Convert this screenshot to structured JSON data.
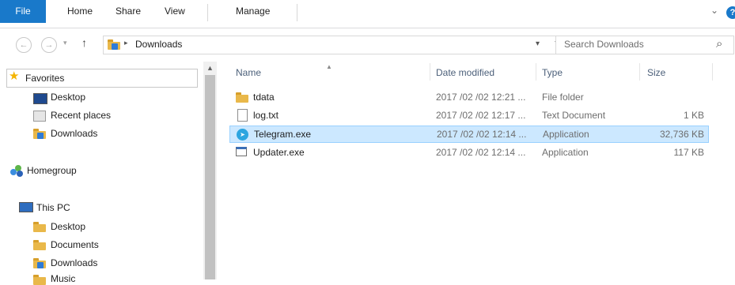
{
  "ribbon": {
    "tabs": [
      "File",
      "Home",
      "Share",
      "View",
      "Manage"
    ],
    "expand_glyph": "⌄",
    "help_glyph": "?"
  },
  "address": {
    "back_glyph": "←",
    "forward_glyph": "→",
    "recent_glyph": "▾",
    "up_glyph": "↑",
    "crumb_sep": "▸",
    "path": "Downloads",
    "dropdown_glyph": "▾",
    "refresh_glyph": "↻",
    "search_placeholder": "Search Downloads",
    "search_glyph": "⌕"
  },
  "nav_pane": {
    "favorites": {
      "label": "Favorites",
      "icon": "star-icon",
      "icon_color": "#f4b400"
    },
    "favorite_items": [
      {
        "label": "Desktop",
        "icon": "desktop-icon"
      },
      {
        "label": "Recent places",
        "icon": "recent-places-icon"
      },
      {
        "label": "Downloads",
        "icon": "downloads-folder-icon"
      }
    ],
    "homegroup": {
      "label": "Homegroup",
      "icon": "homegroup-icon"
    },
    "this_pc": {
      "label": "This PC",
      "icon": "computer-icon"
    },
    "pc_items": [
      {
        "label": "Desktop",
        "icon": "folder-icon"
      },
      {
        "label": "Documents",
        "icon": "documents-folder-icon"
      },
      {
        "label": "Downloads",
        "icon": "downloads-folder-icon"
      },
      {
        "label": "Music",
        "icon": "music-folder-icon"
      }
    ]
  },
  "file_list": {
    "columns": [
      "Name",
      "Date modified",
      "Type",
      "Size"
    ],
    "rows": [
      {
        "name": "tdata",
        "date": "2017 /02 /02 12:21 ...",
        "type": "File folder",
        "size": "",
        "icon": "folder-icon",
        "selected": false
      },
      {
        "name": "log.txt",
        "date": "2017 /02 /02 12:17 ...",
        "type": "Text Document",
        "size": "1 KB",
        "icon": "text-file-icon",
        "selected": false
      },
      {
        "name": "Telegram.exe",
        "date": "2017 /02 /02 12:14 ...",
        "type": "Application",
        "size": "32,736 KB",
        "icon": "telegram-icon",
        "selected": true
      },
      {
        "name": "Updater.exe",
        "date": "2017 /02 /02 12:14 ...",
        "type": "Application",
        "size": "117 KB",
        "icon": "application-icon",
        "selected": false
      }
    ]
  },
  "colors": {
    "accent": "#1979ca",
    "selection": "#cce8ff",
    "selection_border": "#99d1ff",
    "telegram": "#2ca5e0"
  }
}
